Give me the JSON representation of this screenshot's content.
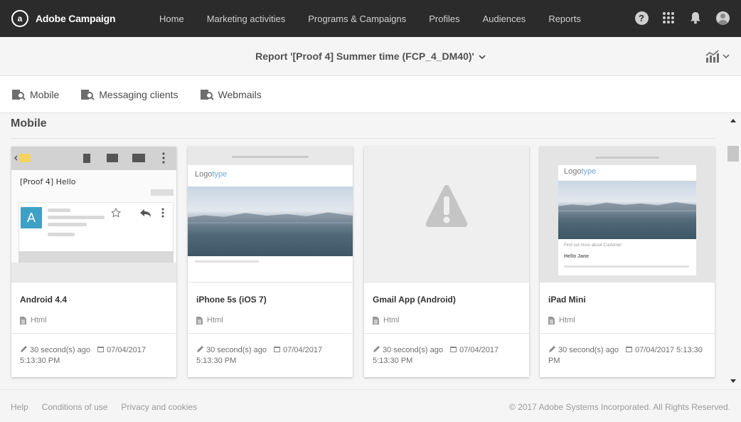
{
  "app": {
    "name": "Adobe Campaign",
    "logo_glyph": "a"
  },
  "nav": [
    {
      "label": "Home"
    },
    {
      "label": "Marketing activities"
    },
    {
      "label": "Programs & Campaigns"
    },
    {
      "label": "Profiles"
    },
    {
      "label": "Audiences"
    },
    {
      "label": "Reports"
    }
  ],
  "top_icons": [
    "help-icon",
    "apps-grid-icon",
    "notifications-bell-icon",
    "user-avatar-icon"
  ],
  "report": {
    "title": "Report '[Proof 4] Summer time (FCP_4_DM40)'"
  },
  "tabs": [
    {
      "label": "Mobile"
    },
    {
      "label": "Messaging clients"
    },
    {
      "label": "Webmails"
    }
  ],
  "section": {
    "title": "Mobile"
  },
  "cards": [
    {
      "name": "Android 4.4",
      "type": "Html",
      "modified": "30 second(s) ago",
      "date": "07/04/2017 5:13:30 PM",
      "thumb_subject": "[Proof 4] Hello",
      "thumb_avatar": "A"
    },
    {
      "name": "iPhone 5s (iOS 7)",
      "type": "Html",
      "modified": "30 second(s) ago",
      "date": "07/04/2017 5:13:30 PM",
      "thumb_logo_a": "Logo",
      "thumb_logo_b": "type"
    },
    {
      "name": "Gmail App (Android)",
      "type": "Html",
      "modified": "30 second(s) ago",
      "date": "07/04/2017 5:13:30 PM"
    },
    {
      "name": "iPad Mini",
      "type": "Html",
      "modified": "30 second(s) ago",
      "date": "07/04/2017 5:13:30 PM",
      "thumb_logo_a": "Logo",
      "thumb_logo_b": "type",
      "thumb_greeting": "Hello Jane",
      "thumb_link": "Find out more about Customer"
    }
  ],
  "footer": {
    "links": [
      {
        "label": "Help"
      },
      {
        "label": "Conditions of use"
      },
      {
        "label": "Privacy and cookies"
      }
    ],
    "copyright": "© 2017 Adobe Systems Incorporated. All Rights Reserved."
  },
  "colors": {
    "topbar": "#2b2b2b",
    "accent_link": "#6fa8dc",
    "avatar_blue": "#3fa0c6"
  }
}
